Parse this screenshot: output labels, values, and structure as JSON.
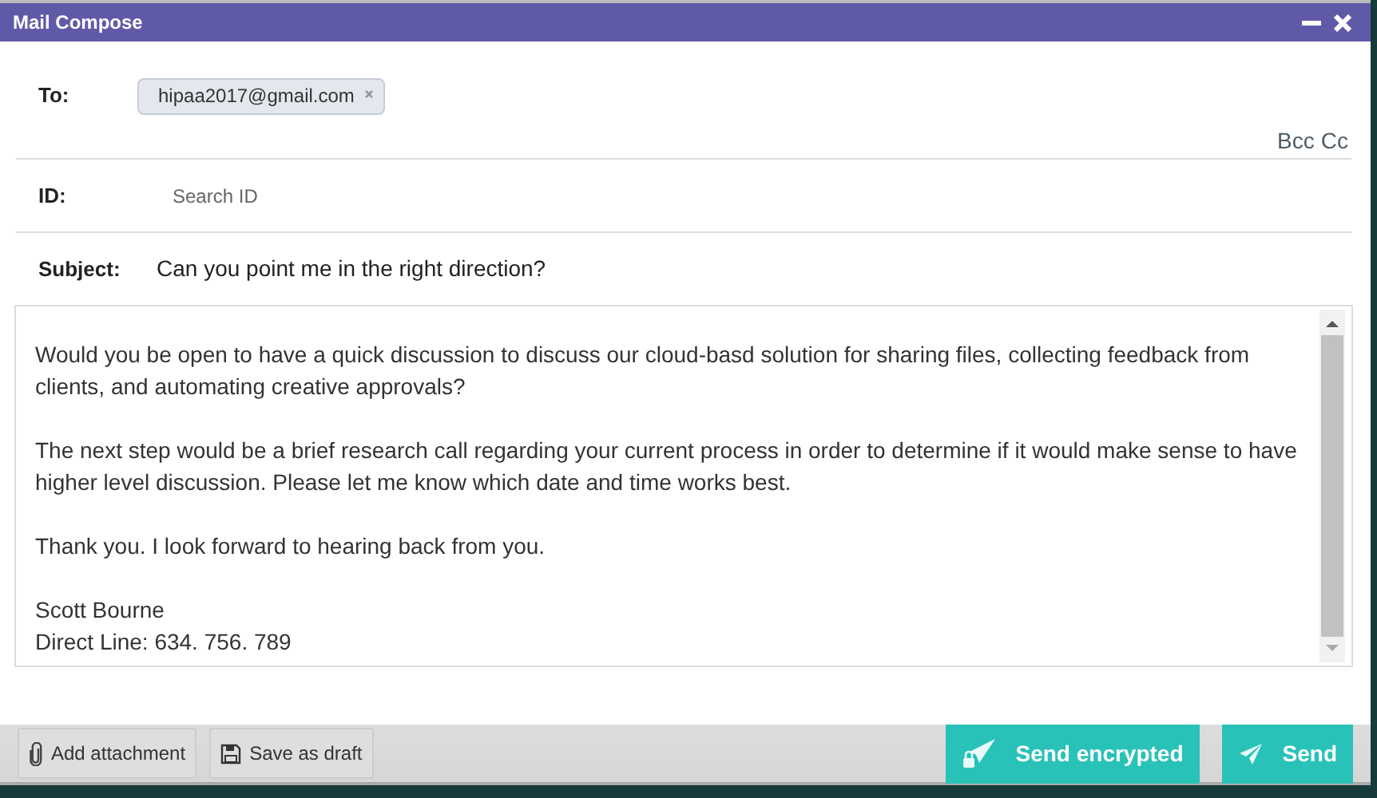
{
  "window": {
    "title": "Mail Compose"
  },
  "to": {
    "label": "To:",
    "recipients": [
      "hipaa2017@gmail.com"
    ],
    "links": [
      "Bcc",
      "Cc"
    ]
  },
  "id": {
    "label": "ID:",
    "placeholder": "Search ID"
  },
  "subject": {
    "label": "Subject:",
    "value": "Can you point me in the right direction?"
  },
  "body": {
    "paragraphs": [
      [
        "Would you be open to have a quick discussion to discuss our cloud-basd solution for sharing files, collecting feedback from clients, and automating creative approvals?"
      ],
      [
        "The next step would be a brief research call regarding your current process in order to determine if it would make sense to have higher level discussion. Please let me know which date and time works best."
      ],
      [
        "Thank you. I look forward to hearing back from you."
      ],
      [
        "Scott Bourne",
        "Direct Line: 634. 756. 789"
      ]
    ]
  },
  "footer": {
    "left_buttons": [
      {
        "label": "Add attachment",
        "kind": "attach"
      },
      {
        "label": "Save as draft",
        "kind": "draft"
      }
    ],
    "right_buttons": [
      {
        "label": "Send encrypted",
        "kind": "encrypted"
      },
      {
        "label": "Send",
        "kind": "send"
      }
    ]
  }
}
